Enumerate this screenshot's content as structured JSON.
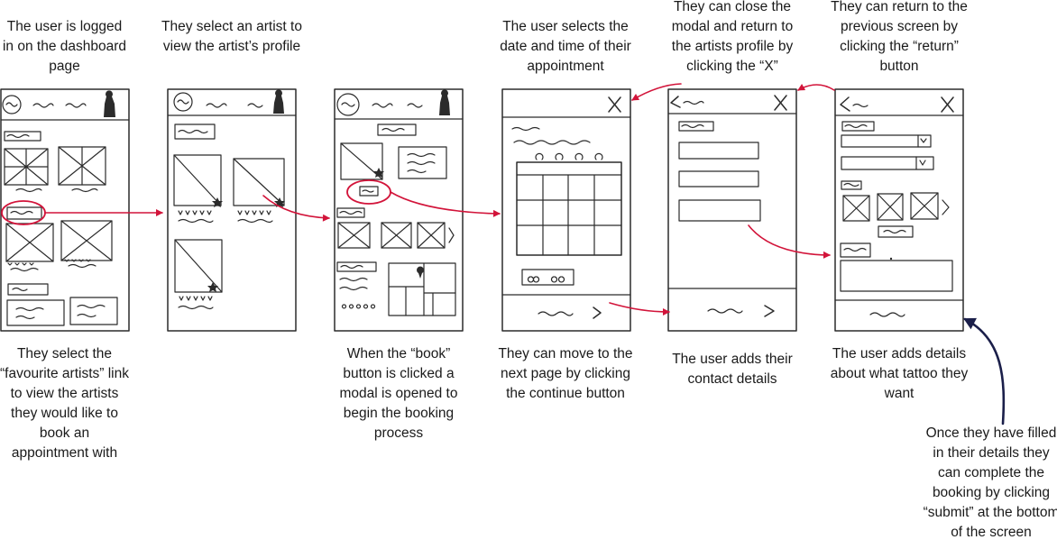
{
  "captions": {
    "top_1": "The user is logged in on the dashboard page",
    "top_2": "They select an artist to view the artist’s profile",
    "top_4": "The user selects the date and time of their appointment",
    "top_5": "They can close the modal and return to the artists profile by clicking the “X”",
    "top_6": "They can return to the previous screen by clicking the “return” button",
    "bottom_1": "They select the “favourite artists” link to view the artists they would like to book an appointment with",
    "bottom_3": "When the “book” button is clicked a modal is opened to begin the booking process",
    "bottom_4": "They can move to the next page by clicking the continue button",
    "bottom_5": "The user adds their contact details",
    "bottom_6": "The user adds details about what tattoo they want",
    "side_note": "Once they have filled in their details they can complete the booking by clicking “submit” at the bottom of the screen"
  },
  "wireframes": [
    {
      "id": "dashboard",
      "screen": "Dashboard"
    },
    {
      "id": "favourite-artists",
      "screen": "Favourite artists"
    },
    {
      "id": "artist-profile",
      "screen": "Artist profile"
    },
    {
      "id": "booking-date-time",
      "screen": "Booking – date and time"
    },
    {
      "id": "booking-contact",
      "screen": "Booking – contact details"
    },
    {
      "id": "booking-tattoo-details",
      "screen": "Booking – tattoo details"
    }
  ],
  "colors": {
    "flow_arrow": "#d2143a",
    "submit_arrow": "#1b1f4a",
    "sketch": "#2b2b2b"
  }
}
